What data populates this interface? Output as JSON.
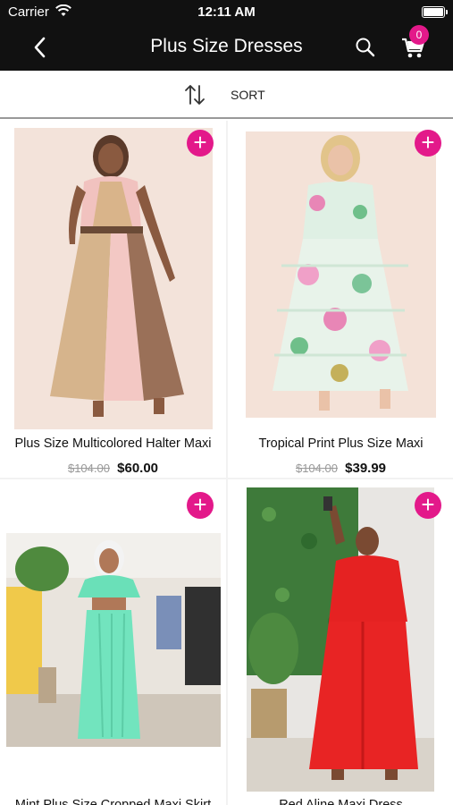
{
  "status_bar": {
    "carrier": "Carrier",
    "time": "12:11 AM"
  },
  "nav": {
    "title": "Plus Size Dresses",
    "cart_count": "0"
  },
  "sort": {
    "label": "SORT"
  },
  "products": [
    {
      "name": "Plus Size Multicolored Halter Maxi",
      "old_price": "$104.00",
      "price": "$60.00"
    },
    {
      "name": "Tropical Print Plus Size Maxi",
      "old_price": "$104.00",
      "price": "$39.99"
    },
    {
      "name": "Mint Plus Size Cropped Maxi Skirt",
      "old_price": "",
      "price": ""
    },
    {
      "name": "Red Aline Maxi Dress",
      "old_price": "",
      "price": ""
    }
  ],
  "colors": {
    "accent": "#e3198a",
    "nav_bg": "#111111"
  }
}
